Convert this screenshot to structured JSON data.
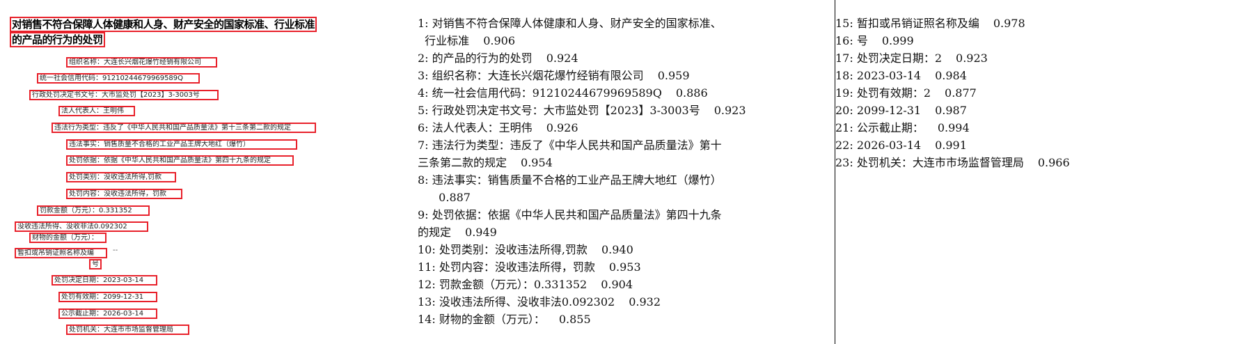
{
  "image": {
    "title_lines": [
      "对销售不符合保障人体健康和人身、财产安全的国家标准、行业标准",
      "的产品的行为的处罚"
    ],
    "fields": [
      {
        "label": "组织名称：",
        "value": "大连长兴烟花爆竹经销有限公司"
      },
      {
        "label": "统一社会信用代码：",
        "value": "91210244679969589Q"
      },
      {
        "label": "行政处罚决定书文号：",
        "value": "大市监处罚【2023】3-3003号"
      },
      {
        "label": "法人代表人：",
        "value": "王明伟"
      },
      {
        "label": "违法行为类型：",
        "value": "违反了《中华人民共和国产品质量法》第十三条第二款的规定"
      },
      {
        "label": "违法事实：",
        "value": "销售质量不合格的工业产品王牌大地红（爆竹）"
      },
      {
        "label": "处罚依据：",
        "value": "依据《中华人民共和国产品质量法》第四十九条的规定"
      },
      {
        "label": "处罚类别：",
        "value": "没收违法所得,罚款"
      },
      {
        "label": "处罚内容：",
        "value": "没收违法所得，罚款"
      },
      {
        "label": "罚款金额（万元）：",
        "value": "0.331352"
      },
      {
        "label": "没收违法所得、没收非法",
        "value": "0.092302"
      },
      {
        "label": "财物的金额（万元）：",
        "value": ""
      },
      {
        "label": "暂扣或吊销证照名称及编",
        "value": "--"
      },
      {
        "label": "号",
        "value": ""
      },
      {
        "label": "处罚决定日期：",
        "value": "2023-03-14"
      },
      {
        "label": "处罚有效期：",
        "value": "2099-12-31"
      },
      {
        "label": "公示截止期：",
        "value": "2026-03-14"
      },
      {
        "label": "处罚机关：",
        "value": "大连市市场监督管理局"
      }
    ]
  },
  "ocr_results": {
    "middle": [
      {
        "idx": "1:",
        "text": "对销售不符合保障人体健康和人身、财产安全的国家标准、",
        "score": ""
      },
      {
        "idx": "",
        "text": "  行业标准",
        "score": "0.906"
      },
      {
        "idx": "2:",
        "text": "的产品的行为的处罚",
        "score": "0.924"
      },
      {
        "idx": "3:",
        "text": "组织名称：大连长兴烟花爆竹经销有限公司",
        "score": "0.959"
      },
      {
        "idx": "4:",
        "text": "统一社会信用代码：91210244679969589Q",
        "score": "0.886"
      },
      {
        "idx": "5:",
        "text": "行政处罚决定书文号：大市监处罚【2023】3-3003号",
        "score": "0.923"
      },
      {
        "idx": "6:",
        "text": "法人代表人：王明伟",
        "score": "0.926"
      },
      {
        "idx": "7:",
        "text": "违法行为类型：违反了《中华人民共和国产品质量法》第十",
        "score": ""
      },
      {
        "idx": "",
        "text": "三条第二款的规定",
        "score": "0.954"
      },
      {
        "idx": "8:",
        "text": "违法事实：销售质量不合格的工业产品王牌大地红（爆竹）",
        "score": ""
      },
      {
        "idx": "",
        "text": "  ",
        "score": "0.887"
      },
      {
        "idx": "9:",
        "text": "处罚依据：依据《中华人民共和国产品质量法》第四十九条",
        "score": ""
      },
      {
        "idx": "",
        "text": "的规定",
        "score": "0.949"
      },
      {
        "idx": "10:",
        "text": "处罚类别：没收违法所得,罚款",
        "score": "0.940"
      },
      {
        "idx": "11:",
        "text": "处罚内容：没收违法所得，罚款",
        "score": "0.953"
      },
      {
        "idx": "12:",
        "text": "罚款金额（万元）：0.331352",
        "score": "0.904"
      },
      {
        "idx": "13:",
        "text": "没收违法所得、没收非法0.092302",
        "score": "0.932"
      },
      {
        "idx": "14:",
        "text": "财物的金额（万元）：",
        "score": "0.855"
      }
    ],
    "right": [
      {
        "idx": "15:",
        "text": "暂扣或吊销证照名称及编",
        "score": "0.978"
      },
      {
        "idx": "16:",
        "text": "号",
        "score": "0.999"
      },
      {
        "idx": "17:",
        "text": "处罚决定日期：2",
        "score": "0.923"
      },
      {
        "idx": "18:",
        "text": "2023-03-14",
        "score": "0.984"
      },
      {
        "idx": "19:",
        "text": "处罚有效期：2",
        "score": "0.877"
      },
      {
        "idx": "20:",
        "text": "2099-12-31",
        "score": "0.987"
      },
      {
        "idx": "21:",
        "text": "公示截止期：",
        "score": "0.994"
      },
      {
        "idx": "22:",
        "text": "2026-03-14",
        "score": "0.991"
      },
      {
        "idx": "23:",
        "text": "处罚机关：大连市市场监督管理局",
        "score": "0.966"
      }
    ]
  }
}
